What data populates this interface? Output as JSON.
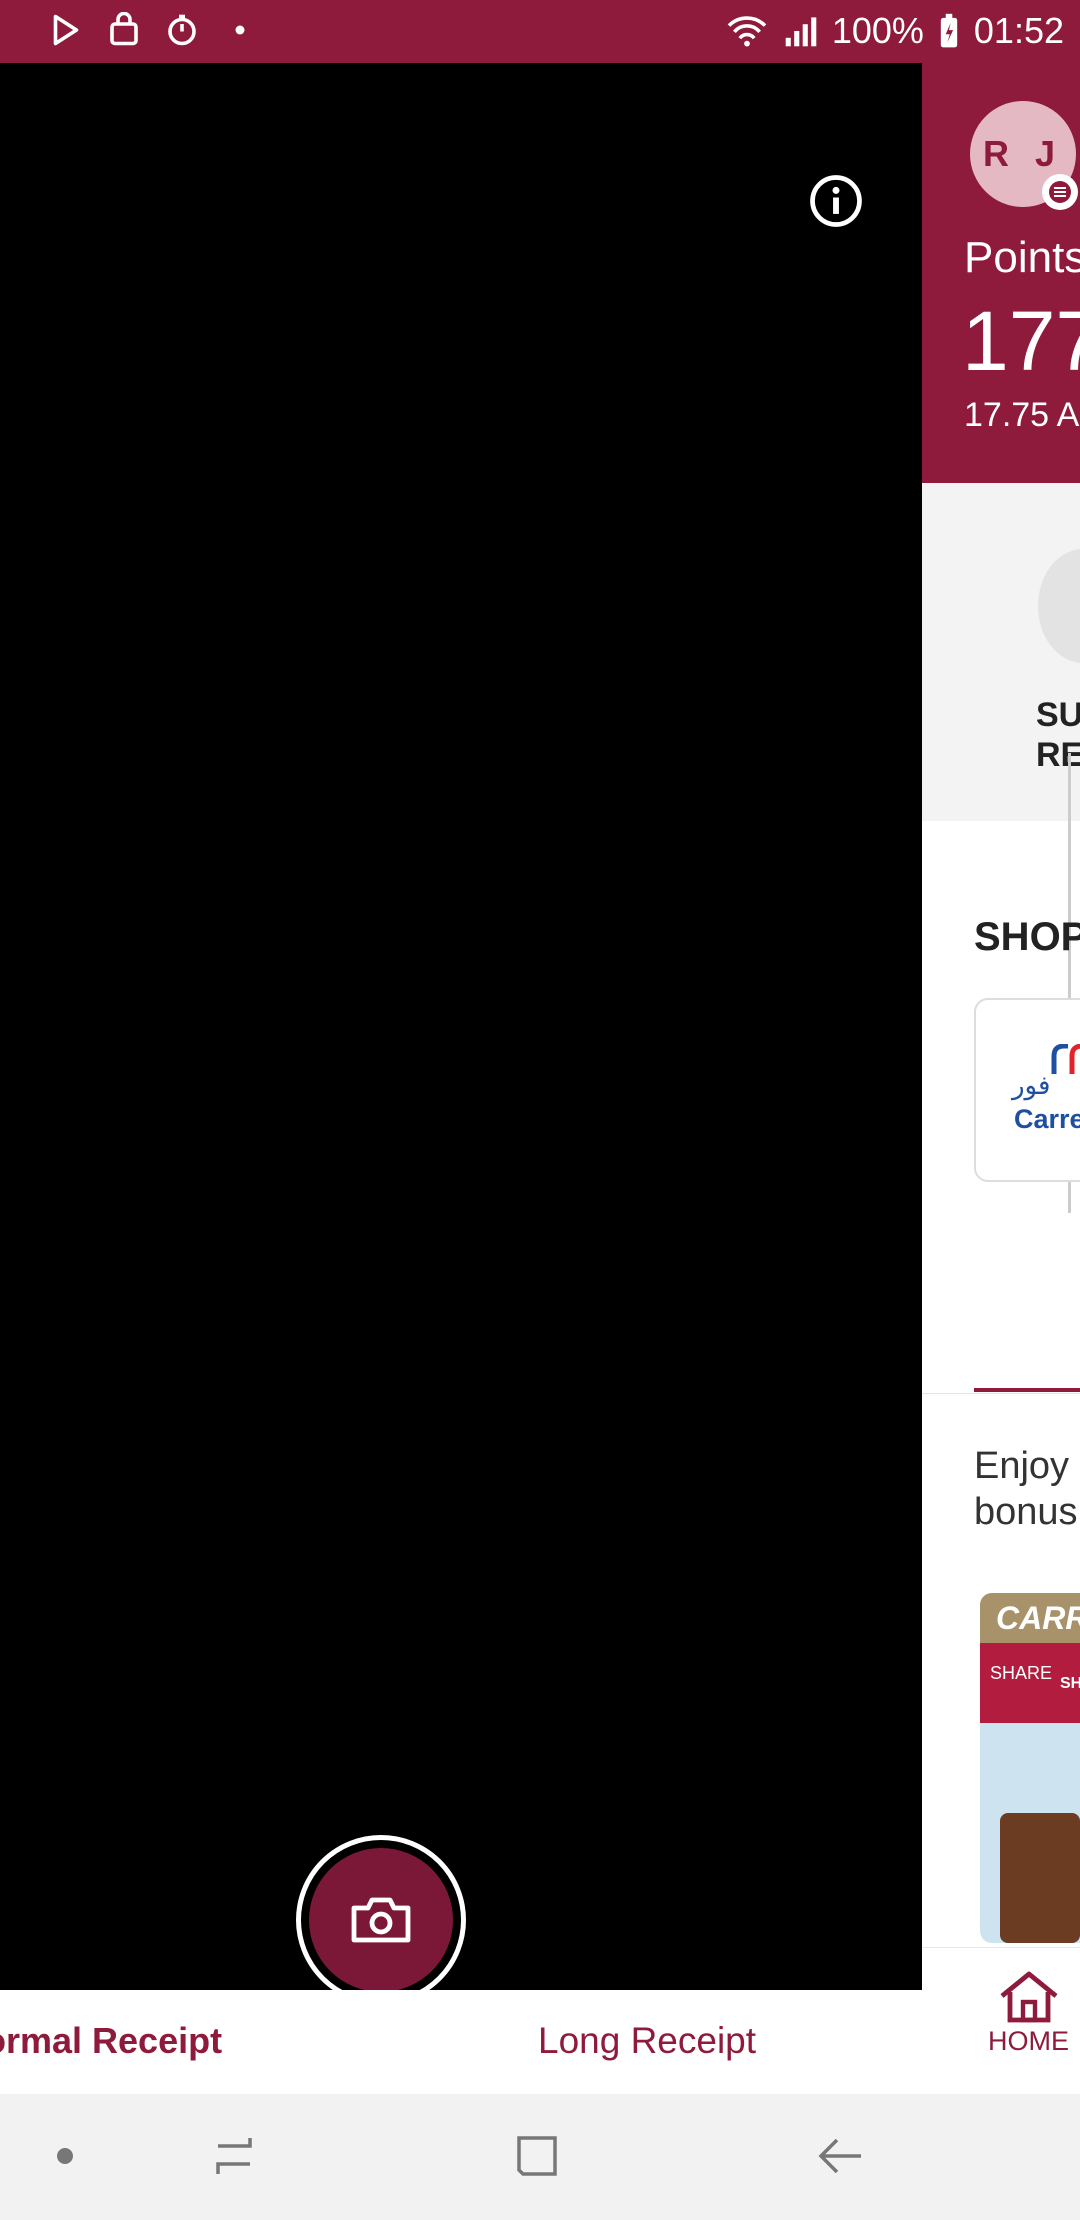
{
  "status_bar": {
    "icons_left": [
      "play-store-icon",
      "shopping-bag-icon",
      "timer-icon",
      "dot-icon"
    ],
    "battery": "100%",
    "time": "01:52"
  },
  "camera": {
    "info_icon": "info-icon",
    "shutter_icon": "camera-icon"
  },
  "receipt_tabs": {
    "normal": "ormal Receipt",
    "long": "Long Receipt"
  },
  "side_panel": {
    "avatar_initials": "R J",
    "points_label": "Points",
    "points_value": "177",
    "points_sub": "17.75 AE",
    "submit_label_line1": "SU",
    "submit_label_line2": "RE",
    "shop_title": "SHOP",
    "shop_logo_ar": "فور",
    "shop_logo_text": "Carre",
    "enjoy_line1": "Enjoy",
    "enjoy_line2": "bonus",
    "promo_top": "CARR",
    "promo_share": "SHARE",
    "promo_share_r": "SH",
    "home_label": "HOME"
  },
  "colors": {
    "brand": "#8e1a3c",
    "shutter": "#7b1838"
  }
}
